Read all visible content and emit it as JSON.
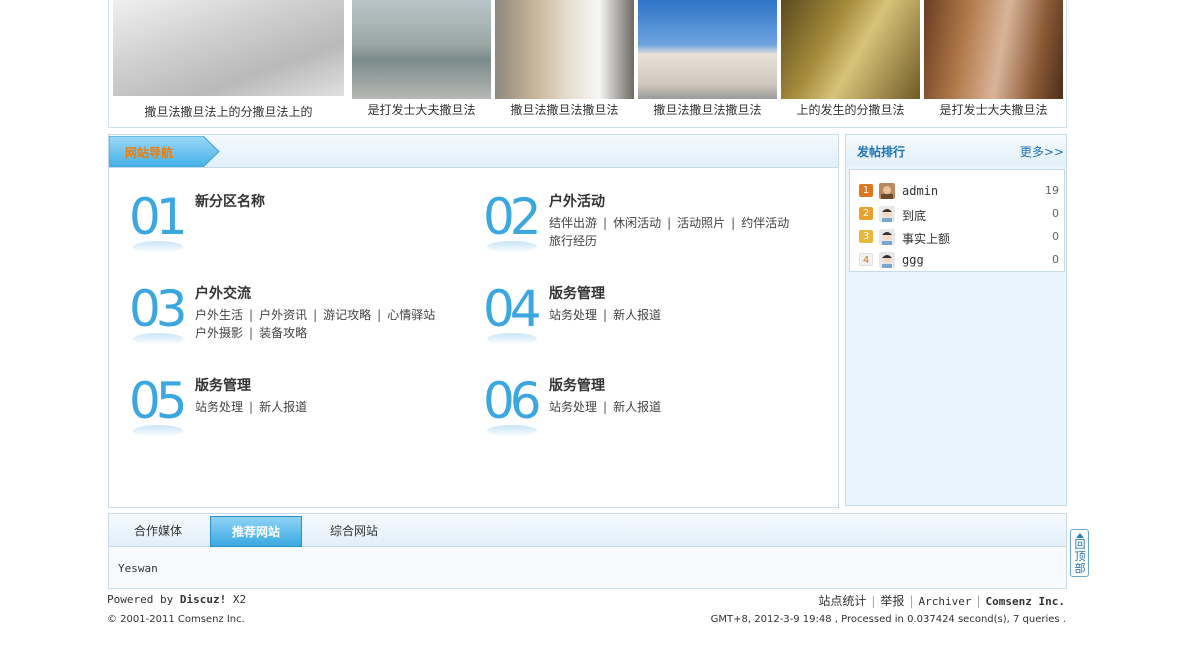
{
  "photos": [
    {
      "caption": "撒旦法撒旦法上的分撒旦法上的"
    },
    {
      "caption": "是打发士大夫撒旦法"
    },
    {
      "caption": "撒旦法撒旦法撒旦法"
    },
    {
      "caption": "撒旦法撒旦法撒旦法"
    },
    {
      "caption": "上的发生的分撒旦法"
    },
    {
      "caption": "是打发士大夫撒旦法"
    }
  ],
  "nav": {
    "tab_label": "网站导航",
    "zones": [
      {
        "num": "01",
        "title": "新分区名称",
        "links": []
      },
      {
        "num": "02",
        "title": "户外活动",
        "links": [
          "结伴出游",
          "休闲活动",
          "活动照片",
          "约伴活动",
          "旅行经历"
        ]
      },
      {
        "num": "03",
        "title": "户外交流",
        "links": [
          "户外生活",
          "户外资讯",
          "游记攻略",
          "心情驿站",
          "户外摄影",
          "装备攻略"
        ]
      },
      {
        "num": "04",
        "title": "版务管理",
        "links": [
          "站务处理",
          "新人报道"
        ]
      },
      {
        "num": "05",
        "title": "版务管理",
        "links": [
          "站务处理",
          "新人报道"
        ]
      },
      {
        "num": "06",
        "title": "版务管理",
        "links": [
          "站务处理",
          "新人报道"
        ]
      }
    ]
  },
  "ranking": {
    "title": "发帖排行",
    "more": "更多>>",
    "rows": [
      {
        "rank": "1",
        "name": "admin",
        "count": "19"
      },
      {
        "rank": "2",
        "name": "到底",
        "count": "0"
      },
      {
        "rank": "3",
        "name": "事实上额",
        "count": "0"
      },
      {
        "rank": "4",
        "name": "ggg",
        "count": "0"
      }
    ]
  },
  "links_box": {
    "tabs": [
      "合作媒体",
      "推荐网站",
      "综合网站"
    ],
    "active_tab": 1,
    "content": "Yeswan"
  },
  "back_to_top": "回顶部",
  "footer": {
    "powered_prefix": "Powered by ",
    "powered_brand": "Discuz!",
    "powered_version": " X2",
    "copyright": "© 2001-2011 Comsenz Inc.",
    "links": [
      "站点统计",
      "举报",
      "Archiver",
      "Comsenz Inc."
    ],
    "stats": "GMT+8, 2012-3-9 19:48 , Processed in 0.037424 second(s), 7 queries ."
  },
  "colors": {
    "accent_blue": "#3aa7e0",
    "nav_tab_text": "#f47b00",
    "rank_badges": [
      "#e0761e",
      "#e8a22c",
      "#e8b63a",
      "#d9d9d9"
    ]
  }
}
